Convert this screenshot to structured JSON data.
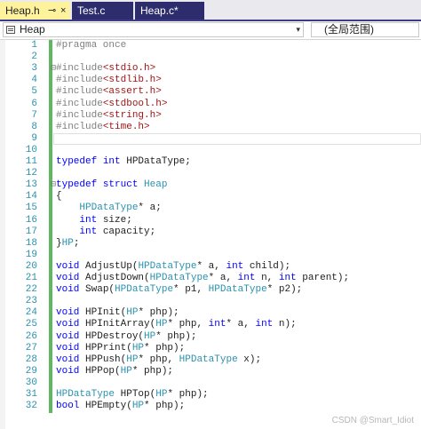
{
  "tabs": [
    {
      "label": "Heap.h",
      "pin": "⊸",
      "close": "×",
      "active": true
    },
    {
      "label": "Test.c",
      "active": false
    },
    {
      "label": "Heap.c*",
      "active": false
    }
  ],
  "navbar": {
    "scope_selector": "Heap",
    "member_selector": "(全局范围)",
    "dropdown_glyph": "▾"
  },
  "editor": {
    "lines": [
      {
        "n": "1",
        "tokens": [
          {
            "t": "#pragma once",
            "c": "c-pp"
          }
        ]
      },
      {
        "n": "2",
        "tokens": []
      },
      {
        "n": "3",
        "fold": "⊟",
        "tokens": [
          {
            "t": "#include",
            "c": "c-pp"
          },
          {
            "t": "<stdio.h>",
            "c": "c-str"
          }
        ]
      },
      {
        "n": "4",
        "tokens": [
          {
            "t": "#include",
            "c": "c-pp"
          },
          {
            "t": "<stdlib.h>",
            "c": "c-str"
          }
        ]
      },
      {
        "n": "5",
        "tokens": [
          {
            "t": "#include",
            "c": "c-pp"
          },
          {
            "t": "<assert.h>",
            "c": "c-str"
          }
        ]
      },
      {
        "n": "6",
        "tokens": [
          {
            "t": "#include",
            "c": "c-pp"
          },
          {
            "t": "<stdbool.h>",
            "c": "c-str"
          }
        ]
      },
      {
        "n": "7",
        "tokens": [
          {
            "t": "#include",
            "c": "c-pp"
          },
          {
            "t": "<string.h>",
            "c": "c-str"
          }
        ]
      },
      {
        "n": "8",
        "tokens": [
          {
            "t": "#include",
            "c": "c-pp"
          },
          {
            "t": "<time.h>",
            "c": "c-str"
          }
        ]
      },
      {
        "n": "9",
        "tokens": [],
        "current": true
      },
      {
        "n": "10",
        "tokens": []
      },
      {
        "n": "11",
        "tokens": [
          {
            "t": "typedef ",
            "c": "c-kw"
          },
          {
            "t": "int ",
            "c": "c-kw"
          },
          {
            "t": "HPDataType;",
            "c": "c-plain"
          }
        ]
      },
      {
        "n": "12",
        "tokens": []
      },
      {
        "n": "13",
        "fold": "⊟",
        "tokens": [
          {
            "t": "typedef ",
            "c": "c-kw"
          },
          {
            "t": "struct ",
            "c": "c-kw"
          },
          {
            "t": "Heap",
            "c": "c-type"
          }
        ]
      },
      {
        "n": "14",
        "tokens": [
          {
            "t": "{",
            "c": "c-plain"
          }
        ]
      },
      {
        "n": "15",
        "tokens": [
          {
            "t": "    ",
            "c": "c-plain"
          },
          {
            "t": "HPDataType",
            "c": "c-type"
          },
          {
            "t": "* a;",
            "c": "c-plain"
          }
        ]
      },
      {
        "n": "16",
        "tokens": [
          {
            "t": "    ",
            "c": "c-plain"
          },
          {
            "t": "int ",
            "c": "c-kw"
          },
          {
            "t": "size;",
            "c": "c-plain"
          }
        ]
      },
      {
        "n": "17",
        "tokens": [
          {
            "t": "    ",
            "c": "c-plain"
          },
          {
            "t": "int ",
            "c": "c-kw"
          },
          {
            "t": "capacity;",
            "c": "c-plain"
          }
        ]
      },
      {
        "n": "18",
        "tokens": [
          {
            "t": "}",
            "c": "c-plain"
          },
          {
            "t": "HP",
            "c": "c-type"
          },
          {
            "t": ";",
            "c": "c-plain"
          }
        ]
      },
      {
        "n": "19",
        "tokens": []
      },
      {
        "n": "20",
        "tokens": [
          {
            "t": "void ",
            "c": "c-kw"
          },
          {
            "t": "AdjustUp(",
            "c": "c-plain"
          },
          {
            "t": "HPDataType",
            "c": "c-type"
          },
          {
            "t": "* a, ",
            "c": "c-plain"
          },
          {
            "t": "int ",
            "c": "c-kw"
          },
          {
            "t": "child);",
            "c": "c-plain"
          }
        ]
      },
      {
        "n": "21",
        "tokens": [
          {
            "t": "void ",
            "c": "c-kw"
          },
          {
            "t": "AdjustDown(",
            "c": "c-plain"
          },
          {
            "t": "HPDataType",
            "c": "c-type"
          },
          {
            "t": "* a, ",
            "c": "c-plain"
          },
          {
            "t": "int ",
            "c": "c-kw"
          },
          {
            "t": "n, ",
            "c": "c-plain"
          },
          {
            "t": "int ",
            "c": "c-kw"
          },
          {
            "t": "parent);",
            "c": "c-plain"
          }
        ]
      },
      {
        "n": "22",
        "tokens": [
          {
            "t": "void ",
            "c": "c-kw"
          },
          {
            "t": "Swap(",
            "c": "c-plain"
          },
          {
            "t": "HPDataType",
            "c": "c-type"
          },
          {
            "t": "* p1, ",
            "c": "c-plain"
          },
          {
            "t": "HPDataType",
            "c": "c-type"
          },
          {
            "t": "* p2);",
            "c": "c-plain"
          }
        ]
      },
      {
        "n": "23",
        "tokens": []
      },
      {
        "n": "24",
        "tokens": [
          {
            "t": "void ",
            "c": "c-kw"
          },
          {
            "t": "HPInit(",
            "c": "c-plain"
          },
          {
            "t": "HP",
            "c": "c-type"
          },
          {
            "t": "* php);",
            "c": "c-plain"
          }
        ]
      },
      {
        "n": "25",
        "tokens": [
          {
            "t": "void ",
            "c": "c-kw"
          },
          {
            "t": "HPInitArray(",
            "c": "c-plain"
          },
          {
            "t": "HP",
            "c": "c-type"
          },
          {
            "t": "* php, ",
            "c": "c-plain"
          },
          {
            "t": "int",
            "c": "c-kw"
          },
          {
            "t": "* a, ",
            "c": "c-plain"
          },
          {
            "t": "int ",
            "c": "c-kw"
          },
          {
            "t": "n);",
            "c": "c-plain"
          }
        ]
      },
      {
        "n": "26",
        "tokens": [
          {
            "t": "void ",
            "c": "c-kw"
          },
          {
            "t": "HPDestroy(",
            "c": "c-plain"
          },
          {
            "t": "HP",
            "c": "c-type"
          },
          {
            "t": "* php);",
            "c": "c-plain"
          }
        ]
      },
      {
        "n": "27",
        "tokens": [
          {
            "t": "void ",
            "c": "c-kw"
          },
          {
            "t": "HPPrint(",
            "c": "c-plain"
          },
          {
            "t": "HP",
            "c": "c-type"
          },
          {
            "t": "* php);",
            "c": "c-plain"
          }
        ]
      },
      {
        "n": "28",
        "tokens": [
          {
            "t": "void ",
            "c": "c-kw"
          },
          {
            "t": "HPPush(",
            "c": "c-plain"
          },
          {
            "t": "HP",
            "c": "c-type"
          },
          {
            "t": "* php, ",
            "c": "c-plain"
          },
          {
            "t": "HPDataType",
            "c": "c-type"
          },
          {
            "t": " x);",
            "c": "c-plain"
          }
        ]
      },
      {
        "n": "29",
        "tokens": [
          {
            "t": "void ",
            "c": "c-kw"
          },
          {
            "t": "HPPop(",
            "c": "c-plain"
          },
          {
            "t": "HP",
            "c": "c-type"
          },
          {
            "t": "* php);",
            "c": "c-plain"
          }
        ]
      },
      {
        "n": "30",
        "tokens": []
      },
      {
        "n": "31",
        "tokens": [
          {
            "t": "HPDataType",
            "c": "c-type"
          },
          {
            "t": " HPTop(",
            "c": "c-plain"
          },
          {
            "t": "HP",
            "c": "c-type"
          },
          {
            "t": "* php);",
            "c": "c-plain"
          }
        ]
      },
      {
        "n": "32",
        "tokens": [
          {
            "t": "bool ",
            "c": "c-kw"
          },
          {
            "t": "HPEmpty(",
            "c": "c-plain"
          },
          {
            "t": "HP",
            "c": "c-type"
          },
          {
            "t": "* php);",
            "c": "c-plain"
          }
        ]
      }
    ]
  },
  "watermark": "CSDN @Smart_Idiot",
  "colors": {
    "active_tab": "#fff29d",
    "inactive_tab": "#2d2d6e",
    "keyword": "#0000ff",
    "type": "#2b91af",
    "preprocessor": "#808080",
    "string": "#a31515",
    "line_number": "#2b91af",
    "change_bar": "#5fb75f"
  }
}
